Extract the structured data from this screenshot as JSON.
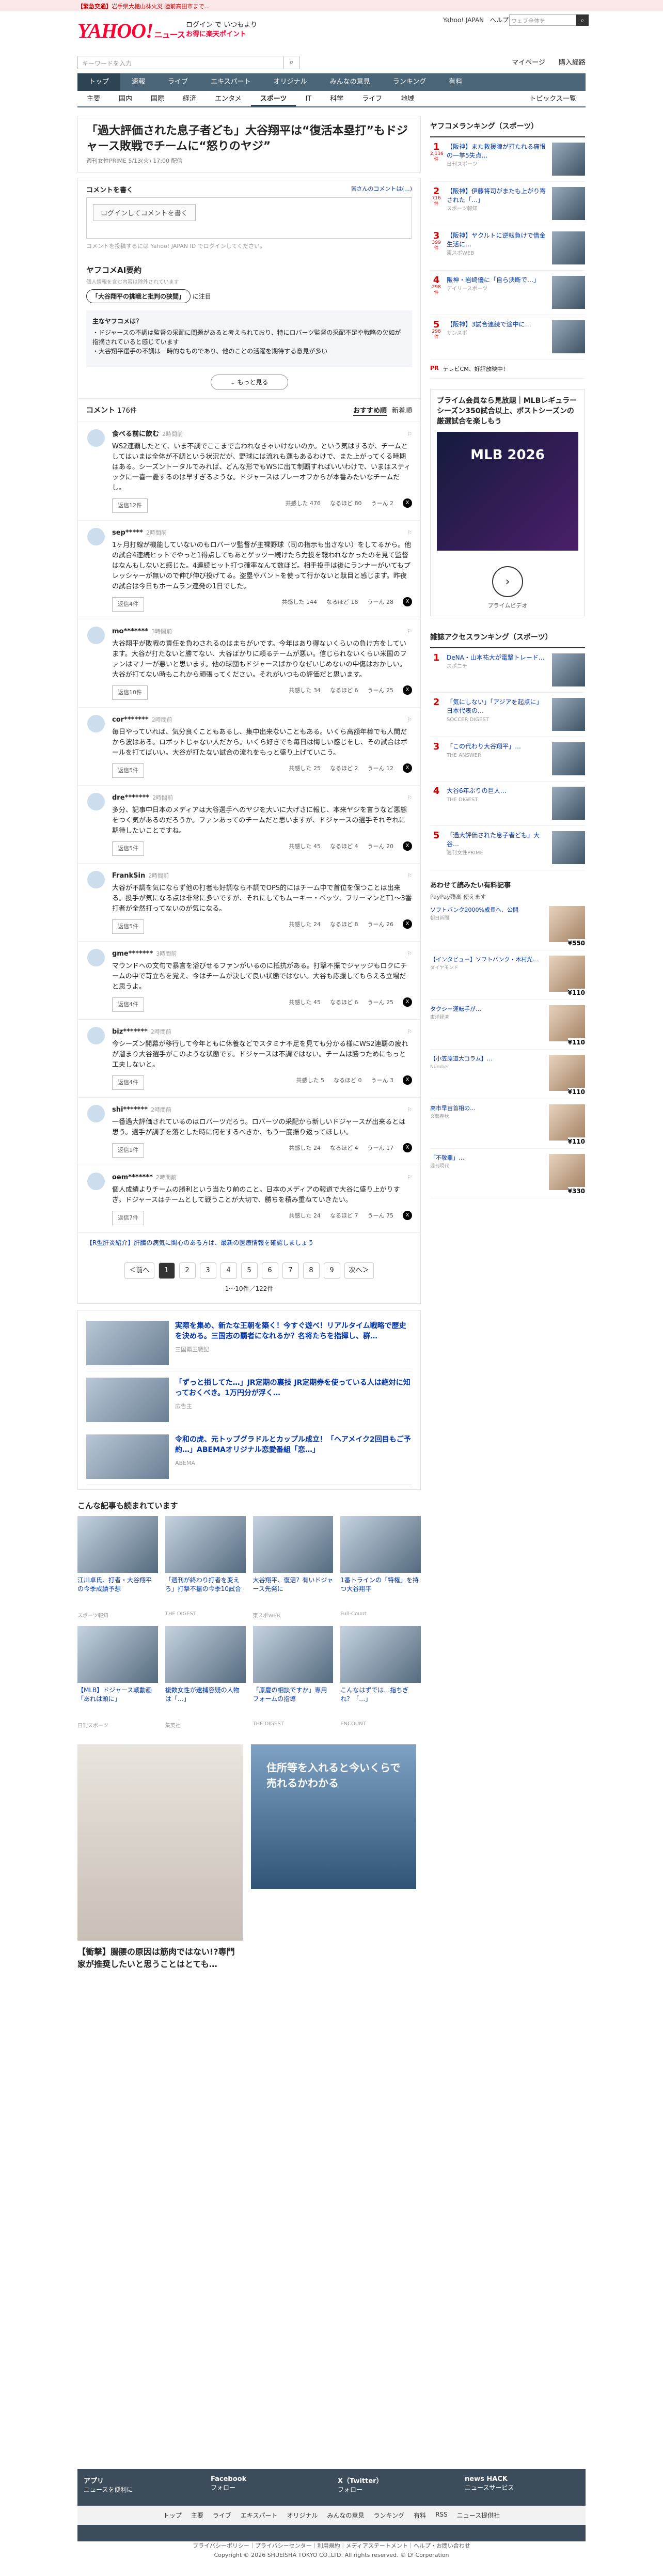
{
  "alert": {
    "prefix": "【緊急交通】",
    "text": "岩手県大槌山林火災 陸前高田市まで…"
  },
  "header": {
    "logo": "YAHOO!",
    "logo_sub": "ニュース",
    "promo_line1": "ログイン で いつもより",
    "promo_line2": "お得に楽天ポイント",
    "links": [
      "Yahoo! JAPAN",
      "ヘルプ"
    ],
    "search_placeholder": "ウェブ全体を",
    "sub_search_placeholder": "キーワードを入力",
    "user_links": [
      "マイページ",
      "購入経路"
    ]
  },
  "nav": {
    "main": [
      "トップ",
      "速報",
      "ライブ",
      "エキスパート",
      "オリジナル",
      "みんなの意見",
      "ランキング",
      "有料"
    ],
    "active_main": "トップ",
    "sub": [
      "主要",
      "国内",
      "国際",
      "経済",
      "エンタメ",
      "スポーツ",
      "IT",
      "科学",
      "ライフ",
      "地域"
    ],
    "active_sub": "スポーツ",
    "sub_right": "トピックス一覧"
  },
  "article": {
    "title": "「過大評価された息子者ども」大谷翔平は“復活本塁打”もドジャース敗戦でチームに“怒りのヤジ”",
    "meta": "週刊女性PRIME  5/13(火) 17:00  配信"
  },
  "comment_login": {
    "heading": "コメントを書く",
    "heading_right": "皆さんのコメントは(…)",
    "box_label": "ログインしてコメントを書く",
    "note": "コメントを投稿するには Yahoo! JAPAN ID でログインしてください。"
  },
  "ai_summary": {
    "heading": "ヤフコメAI要約",
    "note": "個人情報を含む内容は除外されています",
    "chip": "「大谷翔平の挑戦と批判の狭間」",
    "chip_suffix": "に注目",
    "box_title": "主なヤフコメは？",
    "box_lines": [
      "・ドジャースの不調は監督の采配に問題があると考えられており、特にロバーツ監督の采配不足や戦略の欠如が指摘されていると感じています",
      "・大谷翔平選手の不調は一時的なものであり、他のことの活躍を期待する意見が多い"
    ],
    "more": "もっと見る"
  },
  "comments_header": {
    "label": "コメント",
    "count": "176件",
    "sort_label": "おすすめ順",
    "sort_new": "新着順"
  },
  "comments": [
    {
      "name": "食べる前に飲む",
      "time": "2時間前",
      "body": "WS2連覇したとて、いま不調でここまで言われなきゃいけないのか。という気はするが、チームとしてはいまは全体が不調という状況だが、野球には流れも運もあるわけで、また上がってくる時期はある。シーズントータルでみれば、どんな形でもWSに出て制覇すればいいわけで、いまはスティックに一喜一憂するのは早すぎるような。ドジャースはプレーオフからが本番みたいなチームだし。",
      "reply": "返信12件",
      "v1": "共感した 476",
      "v2": "なるほど 80",
      "v3": "うーん 2"
    },
    {
      "name": "sep*****",
      "time": "2時間前",
      "body": "1ヶ月打線が機能していないのもロバーツ監督が主裸野球（司の指示も出さない）をしてるから。他の試合4連続ヒットでやっと1得点してもあとゲッツー続けたら力投を報われなかったのを見て監督はなんもしないと感じた。4連続ヒット打つ確率なんて数ほど。相手投手は後にランナーがいてもプレッシャーが無いので伸び伸び投げてる。盗塁やバントを使って行かないと駄目と感じます。昨夜の試合は今日もホームラン連発の1日でした。",
      "reply": "返信4件",
      "v1": "共感した 144",
      "v2": "なるほど 18",
      "v3": "うーん 28"
    },
    {
      "name": "mo*******",
      "time": "3時間前",
      "body": "大谷翔平が敗戦の責任を負わされるのはまちがいです。今年はあり得ないくらいの負け方をしています。大谷が打たないと勝てない、大谷ばかりに頼るチームが悪い。信じられないくらい米国のファンはマナーが悪いと思います。他の球団もドジャースばかりなぜいじめないの中傷はおかしい。大谷が打てない時もこれから頑張ってください。それがいつもの評価だと思います。",
      "reply": "返信10件",
      "v1": "共感した 34",
      "v2": "なるほど 6",
      "v3": "うーん 25"
    },
    {
      "name": "cor*******",
      "time": "2時間前",
      "body": "毎日やっていれば、気分良くこともあるし、集中出来ないこともある。いくら高額年棒でも人間だから波はある。ロボットじゃない人だから。いくら好きでも毎日は悔しい感じをし、その試合はボールを打てばいい。大谷が打たない試合の流れをもっと盛り上げていこう。",
      "reply": "返信5件",
      "v1": "共感した 25",
      "v2": "なるほど 2",
      "v3": "うーん 12"
    },
    {
      "name": "dre*******",
      "time": "2時間前",
      "body": "多分、記事中日本のメディアは大谷選手へのヤジを大いに大げさに報じ、本来ヤジを言うなど悪態をつく気があるのだろうか。ファンあってのチームだと思いますが、ドジャースの選手それぞれに期待したいことですね。",
      "reply": "返信5件",
      "v1": "共感した 45",
      "v2": "なるほど 4",
      "v3": "うーん 20"
    },
    {
      "name": "FrankSin",
      "time": "2時間前",
      "body": "大谷が不調を気にならず他の打者も好調なら不調でOPS的にはチーム中で首位を保つことは出来る。投手が気になる点は非常に多いですが、それにしてもムーキー・ベッツ、フリーマンとT1〜3番打者が全然打ってないのが気になる。",
      "reply": "返信5件",
      "v1": "共感した 24",
      "v2": "なるほど 8",
      "v3": "うーん 26"
    },
    {
      "name": "gme*******",
      "time": "3時間前",
      "body": "マウンドへの文句で暴言を浴びせるファンがいるのに抵抗がある。打撃不振でジャッジもロクにチームの中で苛立ちを覚え、今はチームが決して良い状態ではない。大谷も応援してもらえる立場だと思うよ。",
      "reply": "返信4件",
      "v1": "共感した 45",
      "v2": "なるほど 6",
      "v3": "うーん 25"
    },
    {
      "name": "biz*******",
      "time": "2時間前",
      "body": "今シーズン開幕が移行して今年ともに休養などでスタミナ不足を見ても分かる様にWS2連覇の疲れが溜まり大谷選手がこのような状態です。ドジャースは不調ではない。チームは勝つためにもっと工夫しないと。",
      "reply": "返信4件",
      "v1": "共感した 5",
      "v2": "なるほど 0",
      "v3": "うーん 3"
    },
    {
      "name": "shi*******",
      "time": "2時間前",
      "body": "一番過大評価されているのはロバーツだろう。ロバーツの采配から新しいドジャースが出来るとは思う。選手が調子を落とした時に何をするべきか、もう一度振り返ってほしい。",
      "reply": "返信1件",
      "v1": "共感した 24",
      "v2": "なるほど 4",
      "v3": "うーん 17"
    },
    {
      "name": "oem*******",
      "time": "2時間前",
      "body": "個人成績よりチームの勝利という当たり前のこと。日本のメディアの報道で大谷に盛り上がりすぎ。ドジャースはチームとして戦うことが大切で、勝ちを積み重ねていきたい。",
      "reply": "返信7件",
      "v1": "共感した 24",
      "v2": "なるほど 7",
      "v3": "うーん 75"
    }
  ],
  "expert_note": "【R型肝炎紹介】肝臓の病気に関心のある方は、最新の医療情報を確認しましょう",
  "pager": {
    "prev": "＜前へ",
    "pages": [
      "1",
      "2",
      "3",
      "4",
      "5",
      "6",
      "7",
      "8",
      "9"
    ],
    "current": "1",
    "next": "次へ＞",
    "info": "1〜10件／122件"
  },
  "ads": [
    {
      "title": "実際を集め、新たな王朝を築く！今すぐ遊べ！リアルタイム戦略で歴史を決める。三国志の覇者になれるか？名将たちを指揮し、群…",
      "src": "三国覇王戦記"
    },
    {
      "title": "「ずっと損してた…」JR定期の裏技 JR定期券を使っている人は絶対に知っておくべき。1万円分が浮く…",
      "src": "広告主"
    },
    {
      "title": "令和の虎、元トップグラドルとカップル成立！「ヘアメイク2回目もご予約…」ABEMAオリジナル恋愛番組「恋…」",
      "src": "ABEMA"
    }
  ],
  "related": {
    "heading": "こんな記事も読まれています",
    "items": [
      {
        "title": "江川卓氏、打者・大谷翔平の今季成績予想",
        "meta": "スポーツ報知"
      },
      {
        "title": "「週刊が終わり打者を変えろ」打撃不振の今季10試合",
        "meta": "THE DIGEST"
      },
      {
        "title": "大谷翔平、復活？有いドジャース先発に",
        "meta": "東スポWEB"
      },
      {
        "title": "1番トラインの「特権」を持つ大谷翔平",
        "meta": "Full-Count"
      },
      {
        "title": "【MLB】ドジャース戦動画「あれは頭に」",
        "meta": "日刊スポーツ"
      },
      {
        "title": "複数女性が逮捕容疑の人物は「…」",
        "meta": "集英社"
      },
      {
        "title": "「原慶の相談ですか」専用フォームの指導",
        "meta": "THE DIGEST"
      },
      {
        "title": "こんなはずでは…指ちぎれ？「…」",
        "meta": "ENCOUNT"
      }
    ]
  },
  "big_ad": {
    "left": "【衝撃】腸腰の原因は筋肉ではない!?専門家が推奨したいと思うことはとても…",
    "right": "住所等を入れると今いくらで売れるかわかる"
  },
  "sidebar": {
    "rank_heading": "ヤフコメランキング（スポーツ）",
    "ranks": [
      {
        "n": "1",
        "pts": "2,116件",
        "title": "【阪神】また救援陣が打たれる痛恨の一挙5失点…",
        "meta": "日刊スポーツ"
      },
      {
        "n": "2",
        "pts": "716件",
        "title": "【阪神】伊藤将司がまたも上がり寄された「…」",
        "meta": "スポーツ報知"
      },
      {
        "n": "3",
        "pts": "399件",
        "title": "【阪神】ヤクルトに逆転負けで借金生活に…",
        "meta": "東スポWEB"
      },
      {
        "n": "4",
        "pts": "298件",
        "title": "阪神・岩崎優に「自ら決断で…」",
        "meta": "デイリースポーツ"
      },
      {
        "n": "5",
        "pts": "298件",
        "title": "【阪神】3試合連続で途中に…",
        "meta": "サンスポ"
      }
    ],
    "pr1": "テレビCM、好評放映中！",
    "ad_title": "プライム会員なら見放題｜MLBレギュラーシーズン350試合以上、ポストシーズンの厳選試合を楽しもう",
    "ad_banner": "MLB 2026",
    "ad_caption": "プライムビデオ",
    "access_heading": "雑誌アクセスランキング（スポーツ）",
    "access": [
      {
        "n": "1",
        "title": "DeNA・山本祐大が電撃トレード…",
        "meta": "スポニチ"
      },
      {
        "n": "2",
        "title": "「気にしない」「アジアを起点に」日本代表の…",
        "meta": "SOCCER DIGEST"
      },
      {
        "n": "3",
        "title": "「この代わり大谷翔平」…",
        "meta": "THE ANSWER"
      },
      {
        "n": "4",
        "title": "大谷6年ぶりの巨人…",
        "meta": "THE DIGEST"
      },
      {
        "n": "5",
        "title": "「過大評価された息子者ども」大谷…",
        "meta": "週刊女性PRIME"
      }
    ],
    "shop_heading": "あわせて読みたい有料記事",
    "shop_sub": "PayPay残高 使えます",
    "shop": [
      {
        "title": "ソフトバンク2000%成長へ、公開",
        "meta": "朝日新聞",
        "price": "¥550"
      },
      {
        "title": "【インタビュー】ソフトバンク・木村光…",
        "meta": "ダイヤモンド",
        "price": "¥110"
      },
      {
        "title": "タクシー運転手が…",
        "meta": "東洋経済",
        "price": "¥110"
      },
      {
        "title": "【小笠原道大コラム】…",
        "meta": "Number",
        "price": "¥110"
      },
      {
        "title": "高市早苗首相の…",
        "meta": "文藝春秋",
        "price": "¥110"
      },
      {
        "title": "「不敬罪」…",
        "meta": "週刊現代",
        "price": "¥330"
      }
    ]
  },
  "footer": {
    "apps": [
      {
        "t": "アプリ",
        "d": "ニュースを便利に"
      },
      {
        "t": "Facebook",
        "d": "フォロー"
      },
      {
        "t": "X（Twitter）",
        "d": "フォロー"
      },
      {
        "t": "news HACK",
        "d": "ニュースサービス"
      }
    ],
    "links": [
      "トップ",
      "主要",
      "ライブ",
      "エキスパート",
      "オリジナル",
      "みんなの意見",
      "ランキング",
      "有料",
      "RSS",
      "ニュース提供社"
    ],
    "bottom1": "プライバシーポリシー｜プライバシーセンター｜利用規約｜メディアステートメント｜ヘルプ・お問い合わせ",
    "bottom2": "Copyright © 2026 SHUEISHA TOKYO CO.,LTD. All rights reserved.  © LY Corporation"
  }
}
